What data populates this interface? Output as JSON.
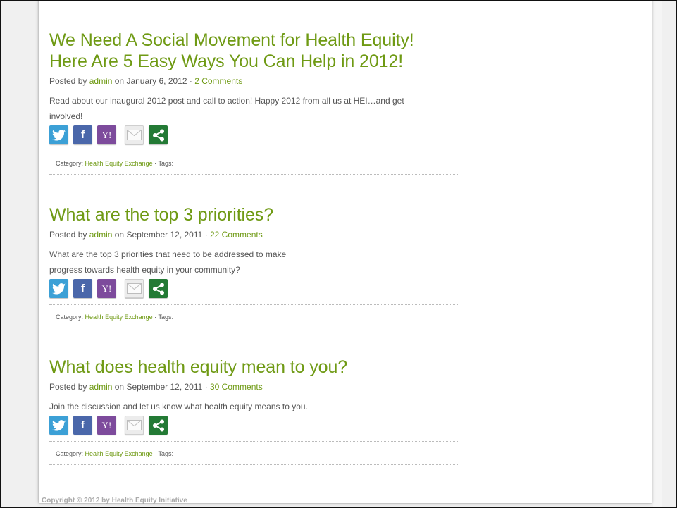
{
  "posts": [
    {
      "title_line1": "We Need A Social Movement for Health Equity!",
      "title_line2": "Here Are 5 Easy Ways You Can Help in 2012!",
      "posted_by": "Posted by",
      "author": "admin",
      "on": "on",
      "date": "January 6, 2012",
      "sep": "·",
      "comments": "2 Comments",
      "excerpt_line1": "Read about our inaugural 2012 post and call to action!  Happy 2012 from all us at HEI…and get",
      "excerpt_line2": "involved!",
      "category_label": "Category:",
      "category": "Health Equity Exchange",
      "tags_label": "· Tags:"
    },
    {
      "title_line1": "What are the top 3 priorities?",
      "posted_by": "Posted by",
      "author": "admin",
      "on": "on",
      "date": "September 12, 2011",
      "sep": "·",
      "comments": "22 Comments",
      "excerpt_line1": "What are the top 3 priorities that need to be addressed to make",
      "excerpt_line2": "progress towards health equity in your community?",
      "category_label": "Category:",
      "category": "Health Equity Exchange",
      "tags_label": "· Tags:"
    },
    {
      "title_line1": "What does health equity mean to you?",
      "posted_by": "Posted by",
      "author": "admin",
      "on": "on",
      "date": "September 12, 2011",
      "sep": "·",
      "comments": "30 Comments",
      "excerpt_line1": "Join the discussion and let us know what health equity means to you.",
      "category_label": "Category:",
      "category": "Health Equity Exchange",
      "tags_label": "· Tags:"
    }
  ],
  "share_icons": [
    "twitter-icon",
    "facebook-icon",
    "yahoo-icon",
    "email-icon",
    "share-icon"
  ],
  "share_glyphs": {
    "facebook": "f",
    "yahoo": "Y!"
  },
  "footer": {
    "copyright": "Copyright © 2012 by Health Equity Initiative"
  },
  "colors": {
    "accent": "#6f9a14",
    "twitter": "#3ca0d6",
    "facebook": "#4a67aa",
    "yahoo": "#7d4b9c",
    "share": "#237a35"
  }
}
